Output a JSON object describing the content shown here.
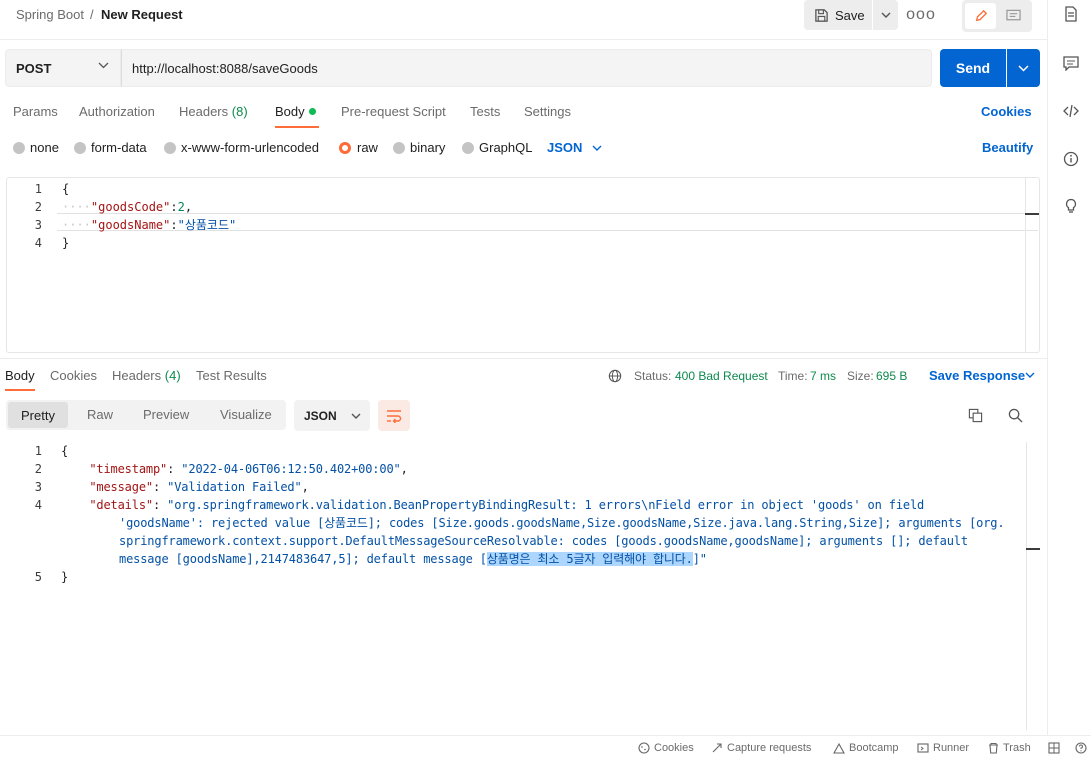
{
  "breadcrumb": {
    "collection": "Spring Boot",
    "separator": "/",
    "request": "New Request"
  },
  "toolbar": {
    "save_label": "Save",
    "more_label": "ooo"
  },
  "request": {
    "method": "POST",
    "url": "http://localhost:8088/saveGoods",
    "send_label": "Send"
  },
  "request_tabs": {
    "params": "Params",
    "authorization": "Authorization",
    "headers": "Headers",
    "headers_count": "(8)",
    "body": "Body",
    "prerequest": "Pre-request Script",
    "tests": "Tests",
    "settings": "Settings",
    "cookies": "Cookies"
  },
  "body_types": {
    "none": "none",
    "form_data": "form-data",
    "urlencoded": "x-www-form-urlencoded",
    "raw": "raw",
    "binary": "binary",
    "graphql": "GraphQL",
    "format": "JSON",
    "beautify": "Beautify"
  },
  "request_body": {
    "line_numbers": [
      "1",
      "2",
      "3",
      "4"
    ],
    "open": "{",
    "key1": "\"goodsCode\"",
    "val1": "2",
    "key2": "\"goodsName\"",
    "val2": "\"상품코드\"",
    "close": "}"
  },
  "response_tabs": {
    "body": "Body",
    "cookies": "Cookies",
    "headers": "Headers",
    "headers_count": "(4)",
    "test_results": "Test Results"
  },
  "response_meta": {
    "status_label": "Status:",
    "status_value": "400 Bad Request",
    "time_label": "Time:",
    "time_value": "7 ms",
    "size_label": "Size:",
    "size_value": "695 B",
    "save_response": "Save Response"
  },
  "response_view": {
    "pretty": "Pretty",
    "raw": "Raw",
    "preview": "Preview",
    "visualize": "Visualize",
    "format": "JSON"
  },
  "response_body": {
    "line_numbers": [
      "1",
      "2",
      "3",
      "4",
      "",
      "",
      "",
      "5"
    ],
    "open": "{",
    "timestamp_key": "\"timestamp\"",
    "timestamp_val": "\"2022-04-06T06:12:50.402+00:00\"",
    "message_key": "\"message\"",
    "message_val": "\"Validation Failed\"",
    "details_key": "\"details\"",
    "details_l1": "\"org.springframework.validation.BeanPropertyBindingResult: 1 errors\\nField error in object 'goods' on field",
    "details_l2": "'goodsName': rejected value [상품코드]; codes [Size.goods.goodsName,Size.goodsName,Size.java.lang.String,Size]; arguments [org.",
    "details_l3": "springframework.context.support.DefaultMessageSourceResolvable: codes [goods.goodsName,goodsName]; arguments []; default",
    "details_l4_pre": "message [goodsName],2147483647,5]; default message [",
    "details_l4_sel": "상품명은 최소 5글자 입력해야 합니다.",
    "details_l4_post": "]\"",
    "close": "}"
  },
  "footer": {
    "cookies": "Cookies",
    "capture": "Capture requests",
    "bootcamp": "Bootcamp",
    "runner": "Runner",
    "trash": "Trash"
  },
  "colors": {
    "accent": "#ff6c37",
    "primary": "#0265d2",
    "success": "#0d8a4d",
    "json_key": "#a31515",
    "json_string": "#0451a5",
    "selection": "#add6ff"
  }
}
